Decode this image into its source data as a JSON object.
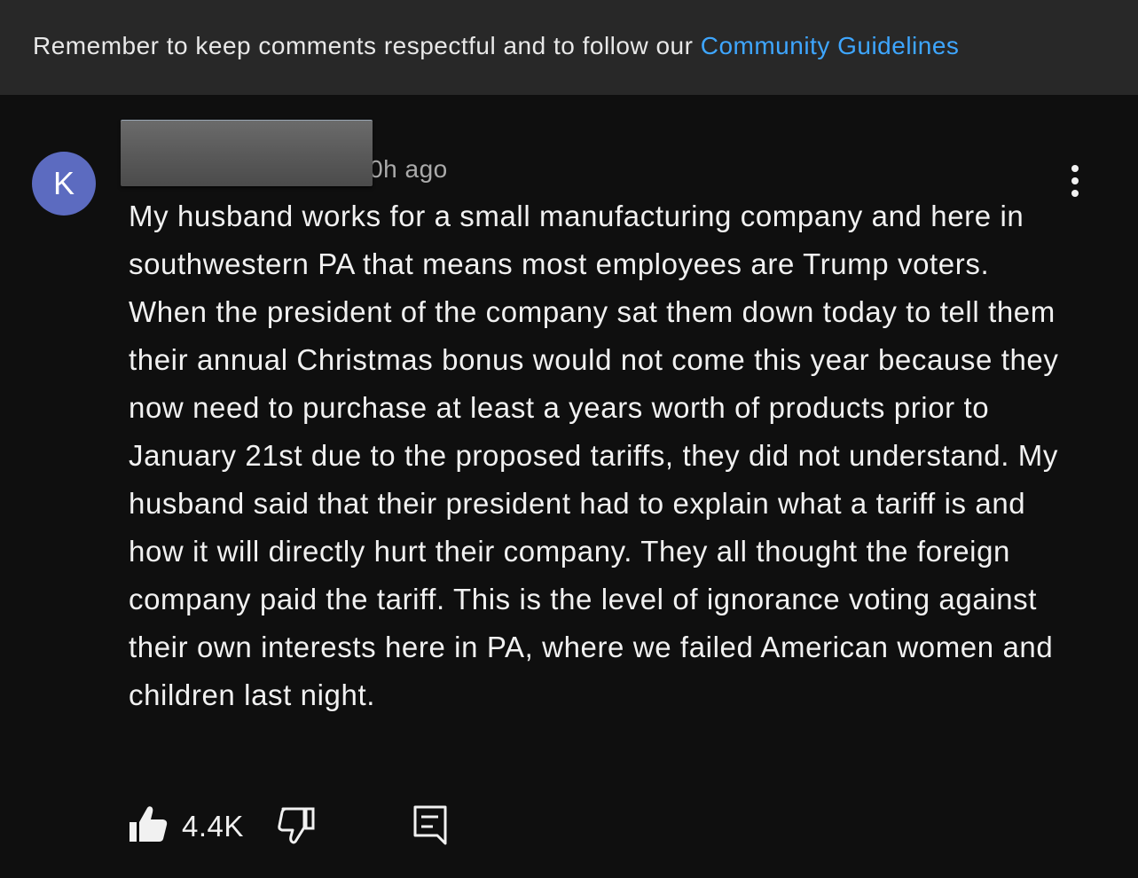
{
  "banner": {
    "text": "Remember to keep comments respectful and to follow our ",
    "link": "Community Guidelines"
  },
  "comment": {
    "avatar_letter": "K",
    "avatar_color": "#5c6bc0",
    "time": "20h ago",
    "body": "My husband works for a small manufacturing company and here in southwestern PA that means most employees are Trump voters. When the president of the company sat them down today to tell them their annual Christmas bonus would not come this year because they now need to purchase at least a years worth of products prior to January 21st due to the proposed tariffs, they did not understand. My husband said that their president had to explain what a tariff is and how it will directly hurt their company. They all thought the foreign company paid the tariff. This is the level of ignorance voting against their own interests here in PA, where we failed American women and children last night.",
    "like_count": "4.4K"
  },
  "icons": {
    "menu": "more-vert-icon",
    "like": "thumbs-up-filled-icon",
    "dislike": "thumbs-down-outline-icon",
    "reply": "reply-comment-icon"
  },
  "colors": {
    "background": "#0f0f0f",
    "banner_background": "#282828",
    "link": "#3ea6ff",
    "secondary_text": "#aaaaaa"
  }
}
